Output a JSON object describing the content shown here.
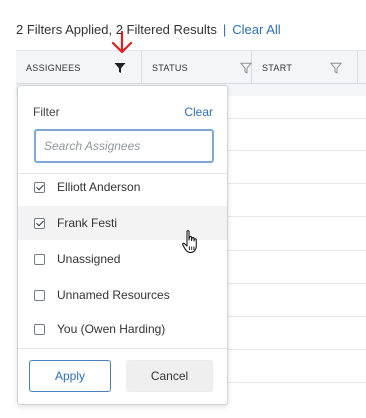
{
  "summary": {
    "text": "2 Filters Applied, 2 Filtered Results",
    "separator": "|",
    "clear_all": "Clear All"
  },
  "table": {
    "columns": [
      {
        "label": "ASSIGNEES",
        "filter_active": true
      },
      {
        "label": "STATUS",
        "filter_active": false
      },
      {
        "label": "START",
        "filter_active": false
      }
    ]
  },
  "filter_dropdown": {
    "title": "Filter",
    "clear_label": "Clear",
    "search": {
      "placeholder": "Search Assignees",
      "value": ""
    },
    "options": [
      {
        "label": "Elliott Anderson",
        "checked": true
      },
      {
        "label": "Frank Festi",
        "checked": true
      },
      {
        "label": "Unassigned",
        "checked": false
      },
      {
        "label": "Unnamed Resources",
        "checked": false
      },
      {
        "label": "You (Owen Harding)",
        "checked": false
      }
    ],
    "apply_label": "Apply",
    "cancel_label": "Cancel"
  },
  "colors": {
    "accent": "#2c6fb7",
    "annotation_arrow": "#e02020",
    "header_bg": "#f4f5f6"
  }
}
